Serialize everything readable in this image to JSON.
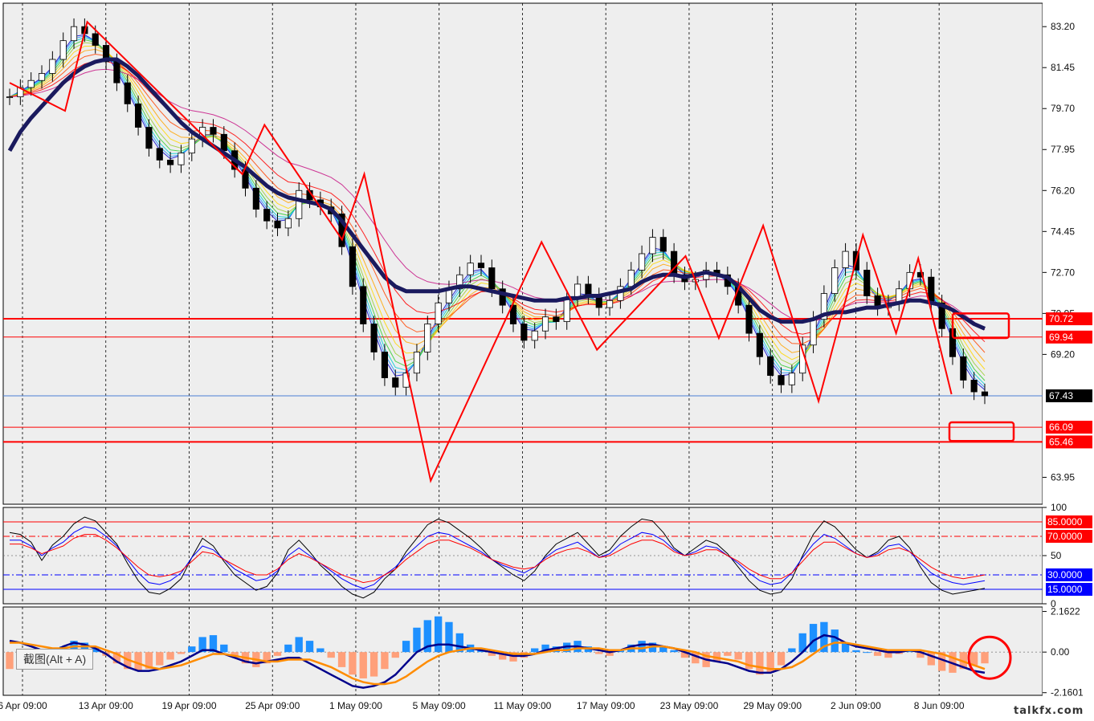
{
  "chart_data": [
    {
      "type": "candlestick",
      "panel": "main",
      "ylim": [
        62.8,
        84.2
      ],
      "y_ticks": [
        "83.20",
        "81.45",
        "79.70",
        "77.95",
        "76.20",
        "74.45",
        "72.70",
        "70.95",
        "69.20",
        "63.95"
      ],
      "x_labels": [
        "6 Apr 09:00",
        "13 Apr 09:00",
        "19 Apr 09:00",
        "25 Apr 09:00",
        "1 May 09:00",
        "5 May 09:00",
        "11 May 09:00",
        "17 May 09:00",
        "23 May 09:00",
        "29 May 09:00",
        "2 Jun 09:00",
        "8 Jun 09:00"
      ],
      "close_path": [
        80.2,
        80.6,
        80.9,
        81.2,
        81.8,
        82.6,
        83.2,
        82.9,
        82.4,
        81.7,
        80.8,
        79.9,
        78.9,
        78.0,
        77.5,
        77.3,
        77.8,
        78.4,
        78.9,
        78.6,
        77.9,
        77.1,
        76.3,
        75.4,
        74.9,
        74.6,
        75.0,
        76.2,
        75.8,
        75.5,
        75.2,
        73.8,
        72.1,
        70.5,
        69.3,
        68.2,
        67.8,
        68.4,
        69.3,
        70.5,
        71.4,
        72.0,
        72.6,
        73.1,
        72.9,
        72.0,
        71.3,
        70.5,
        69.8,
        70.2,
        70.8,
        70.6,
        71.6,
        72.2,
        71.7,
        71.2,
        71.5,
        72.1,
        72.8,
        73.5,
        74.2,
        73.6,
        72.6,
        72.3,
        72.4,
        72.8,
        72.6,
        72.1,
        71.3,
        70.1,
        69.1,
        68.3,
        67.9,
        68.4,
        69.6,
        70.7,
        71.8,
        72.9,
        73.6,
        72.8,
        71.7,
        71.2,
        71.4,
        72.0,
        72.7,
        72.5,
        71.4,
        70.3,
        69.1,
        68.1,
        67.6,
        67.43
      ],
      "series": [
        {
          "name": "EMA 50",
          "values": [
            77.9,
            78.7,
            79.3,
            79.8,
            80.3,
            80.8,
            81.2,
            81.5,
            81.7,
            81.8,
            81.8,
            81.5,
            81.1,
            80.6,
            80.1,
            79.6,
            79.1,
            78.7,
            78.4,
            78.1,
            77.8,
            77.5,
            77.2,
            76.8,
            76.4,
            76.1,
            75.9,
            75.8,
            75.7,
            75.6,
            75.4,
            74.9,
            74.3,
            73.7,
            73.1,
            72.5,
            72.1,
            71.9,
            71.9,
            71.9,
            71.9,
            72.0,
            72.1,
            72.1,
            72.0,
            71.9,
            71.8,
            71.7,
            71.6,
            71.5,
            71.5,
            71.5,
            71.6,
            71.6,
            71.7,
            71.7,
            71.8,
            71.9,
            72.0,
            72.3,
            72.5,
            72.6,
            72.6,
            72.5,
            72.6,
            72.7,
            72.6,
            72.5,
            72.1,
            71.6,
            71.1,
            70.8,
            70.6,
            70.6,
            70.6,
            70.7,
            70.9,
            71.0,
            71.0,
            71.1,
            71.2,
            71.2,
            71.3,
            71.4,
            71.5,
            71.5,
            71.4,
            71.3,
            71.1,
            70.8,
            70.5,
            70.3
          ]
        },
        {
          "name": "ZigZag",
          "points": [
            [
              0,
              80.8
            ],
            [
              5,
              79.6
            ],
            [
              7,
              83.4
            ],
            [
              21,
              76.9
            ],
            [
              23,
              79.0
            ],
            [
              30,
              74.1
            ],
            [
              32,
              76.9
            ],
            [
              38,
              63.8
            ],
            [
              48,
              74.0
            ],
            [
              53,
              69.4
            ],
            [
              61,
              73.4
            ],
            [
              64,
              69.9
            ],
            [
              68,
              74.7
            ],
            [
              73,
              67.2
            ],
            [
              77,
              74.3
            ],
            [
              80,
              70.1
            ],
            [
              82,
              73.3
            ],
            [
              85,
              67.5
            ]
          ]
        }
      ],
      "levels": [
        {
          "value": 70.72,
          "label": "70.72",
          "color": "#ff0000"
        },
        {
          "value": 69.94,
          "label": "69.94",
          "color": "#ff0000"
        },
        {
          "value": 67.43,
          "label": "67.43",
          "color": "#000000"
        },
        {
          "value": 66.09,
          "label": "66.09",
          "color": "#ff0000"
        },
        {
          "value": 65.46,
          "label": "65.46",
          "color": "#ff0000"
        }
      ],
      "grid": true
    },
    {
      "type": "line",
      "panel": "oscillator",
      "ylim": [
        0,
        100
      ],
      "y_ticks": [
        "100",
        "50",
        "0"
      ],
      "levels": [
        {
          "value": 85,
          "label": "85.0000",
          "color": "#ff0000"
        },
        {
          "value": 70,
          "label": "70.0000",
          "color": "#ff0000"
        },
        {
          "value": 30,
          "label": "30.0000",
          "color": "#0000ff"
        },
        {
          "value": 15,
          "label": "15.0000",
          "color": "#0000ff"
        }
      ],
      "series": [
        {
          "values": [
            74,
            72,
            64,
            45,
            61,
            70,
            83,
            90,
            86,
            74,
            62,
            42,
            24,
            12,
            10,
            16,
            26,
            48,
            68,
            60,
            44,
            30,
            22,
            14,
            18,
            32,
            56,
            66,
            54,
            40,
            30,
            18,
            10,
            6,
            12,
            26,
            36,
            54,
            68,
            82,
            88,
            84,
            76,
            68,
            58,
            46,
            38,
            30,
            24,
            34,
            50,
            62,
            68,
            74,
            62,
            50,
            56,
            70,
            80,
            88,
            86,
            74,
            58,
            50,
            58,
            66,
            62,
            52,
            38,
            24,
            14,
            10,
            12,
            26,
            50,
            72,
            86,
            80,
            68,
            56,
            48,
            54,
            66,
            70,
            58,
            38,
            22,
            14,
            10,
            12,
            14,
            16
          ]
        },
        {
          "values": [
            66,
            66,
            60,
            50,
            58,
            64,
            74,
            80,
            78,
            70,
            60,
            46,
            32,
            22,
            20,
            24,
            32,
            48,
            60,
            56,
            46,
            36,
            30,
            24,
            26,
            34,
            50,
            58,
            50,
            42,
            34,
            26,
            20,
            16,
            20,
            30,
            38,
            50,
            60,
            70,
            74,
            72,
            66,
            60,
            54,
            46,
            40,
            36,
            32,
            38,
            48,
            56,
            60,
            64,
            56,
            48,
            52,
            62,
            68,
            74,
            72,
            66,
            56,
            50,
            54,
            60,
            58,
            50,
            42,
            32,
            24,
            20,
            22,
            32,
            48,
            62,
            72,
            68,
            60,
            52,
            48,
            52,
            60,
            62,
            54,
            42,
            32,
            26,
            22,
            20,
            22,
            24
          ]
        },
        {
          "values": [
            62,
            62,
            58,
            52,
            56,
            60,
            68,
            72,
            72,
            66,
            58,
            48,
            38,
            30,
            28,
            30,
            34,
            44,
            54,
            52,
            46,
            40,
            34,
            30,
            30,
            36,
            46,
            52,
            48,
            42,
            36,
            30,
            26,
            22,
            24,
            30,
            36,
            46,
            54,
            62,
            66,
            66,
            62,
            58,
            52,
            46,
            42,
            38,
            36,
            38,
            46,
            52,
            56,
            58,
            54,
            48,
            50,
            56,
            62,
            66,
            66,
            62,
            54,
            50,
            52,
            56,
            56,
            50,
            44,
            36,
            30,
            26,
            26,
            32,
            44,
            56,
            64,
            64,
            58,
            52,
            48,
            50,
            56,
            58,
            54,
            46,
            38,
            32,
            28,
            26,
            28,
            30
          ]
        }
      ],
      "grid": true
    },
    {
      "type": "bar",
      "panel": "macd",
      "ylim": [
        -2.3,
        2.4
      ],
      "y_ticks": [
        "2.1622",
        "0.00",
        "-2.1601"
      ],
      "values": [
        -0.9,
        -0.8,
        -0.6,
        -0.4,
        -0.1,
        0.3,
        0.6,
        0.5,
        0.2,
        -0.2,
        -0.6,
        -0.9,
        -1.0,
        -0.9,
        -0.7,
        -0.4,
        -0.1,
        0.3,
        0.8,
        0.9,
        0.4,
        -0.2,
        -0.6,
        -0.8,
        -0.6,
        -0.2,
        0.4,
        0.8,
        0.6,
        0.2,
        -0.3,
        -0.8,
        -1.2,
        -1.4,
        -1.3,
        -0.9,
        -0.3,
        0.6,
        1.3,
        1.7,
        1.9,
        1.6,
        1.0,
        0.4,
        0.1,
        -0.2,
        -0.4,
        -0.5,
        -0.3,
        0.2,
        0.4,
        0.3,
        0.5,
        0.6,
        0.3,
        -0.1,
        -0.2,
        0.1,
        0.4,
        0.6,
        0.5,
        0.3,
        0.1,
        -0.3,
        -0.6,
        -0.8,
        -0.5,
        -0.2,
        -0.4,
        -0.9,
        -1.2,
        -1.1,
        -0.7,
        0.2,
        1.0,
        1.5,
        1.6,
        1.2,
        0.5,
        0.1,
        0.0,
        -0.2,
        -0.3,
        -0.1,
        0.1,
        -0.3,
        -0.7,
        -1.0,
        -1.1,
        -0.9,
        -0.7,
        -0.6
      ],
      "series": [
        {
          "values": [
            0.6,
            0.5,
            0.3,
            0.1,
            0.0,
            0.3,
            0.5,
            0.4,
            0.2,
            -0.1,
            -0.5,
            -0.8,
            -1.0,
            -1.0,
            -0.9,
            -0.7,
            -0.5,
            -0.2,
            0.1,
            0.1,
            -0.1,
            -0.3,
            -0.5,
            -0.6,
            -0.5,
            -0.4,
            -0.3,
            -0.3,
            -0.6,
            -0.9,
            -1.2,
            -1.5,
            -1.8,
            -1.9,
            -1.8,
            -1.6,
            -1.2,
            -0.6,
            0.0,
            0.3,
            0.4,
            0.4,
            0.3,
            0.2,
            0.1,
            0.0,
            -0.1,
            -0.2,
            -0.2,
            -0.1,
            0.1,
            0.2,
            0.3,
            0.3,
            0.2,
            0.1,
            0.0,
            0.1,
            0.3,
            0.4,
            0.4,
            0.3,
            0.2,
            0.0,
            -0.2,
            -0.4,
            -0.5,
            -0.6,
            -0.8,
            -1.0,
            -1.1,
            -1.1,
            -0.9,
            -0.5,
            0.0,
            0.6,
            0.9,
            0.8,
            0.5,
            0.3,
            0.2,
            0.1,
            0.0,
            0.0,
            0.1,
            0.0,
            -0.2,
            -0.4,
            -0.6,
            -0.8,
            -1.0,
            -1.1
          ]
        },
        {
          "values": [
            0.5,
            0.5,
            0.4,
            0.3,
            0.2,
            0.2,
            0.3,
            0.3,
            0.3,
            0.1,
            -0.1,
            -0.4,
            -0.6,
            -0.8,
            -0.9,
            -0.8,
            -0.7,
            -0.5,
            -0.3,
            -0.1,
            -0.1,
            -0.2,
            -0.3,
            -0.4,
            -0.5,
            -0.5,
            -0.4,
            -0.4,
            -0.4,
            -0.6,
            -0.8,
            -1.1,
            -1.4,
            -1.6,
            -1.7,
            -1.7,
            -1.6,
            -1.3,
            -0.9,
            -0.5,
            -0.2,
            0.0,
            0.1,
            0.2,
            0.2,
            0.1,
            0.0,
            -0.1,
            -0.1,
            -0.1,
            0.0,
            0.1,
            0.1,
            0.2,
            0.2,
            0.2,
            0.1,
            0.1,
            0.2,
            0.2,
            0.3,
            0.3,
            0.2,
            0.1,
            0.0,
            -0.2,
            -0.3,
            -0.4,
            -0.5,
            -0.7,
            -0.8,
            -0.9,
            -0.9,
            -0.8,
            -0.5,
            -0.1,
            0.3,
            0.5,
            0.5,
            0.4,
            0.3,
            0.2,
            0.1,
            0.1,
            0.1,
            0.1,
            0.0,
            -0.1,
            -0.3,
            -0.5,
            -0.7,
            -0.9
          ]
        }
      ],
      "colors": {
        "positive": "#1e90ff",
        "negative": "#ffa07a"
      },
      "grid": true
    }
  ],
  "screenshot_tip": "截图(Alt + A)",
  "watermark": "talkfx.com",
  "colors": {
    "background": "#eeeeee",
    "bull": "#00a000",
    "bear": "#000000",
    "ema": "#1a1a5e",
    "zigzag": "#ff0000",
    "level_red": "#ff0000",
    "level_blue": "#0000ff",
    "price_tag_black": "#000000"
  }
}
